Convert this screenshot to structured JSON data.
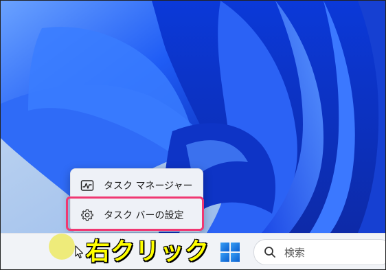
{
  "context_menu": {
    "items": [
      {
        "label": "タスク マネージャー",
        "icon": "task-manager-icon"
      },
      {
        "label": "タスク バーの設定",
        "icon": "gear-icon"
      }
    ]
  },
  "annotation": {
    "text": "右クリック",
    "color": "#ffff00"
  },
  "taskbar": {
    "search": {
      "placeholder": "検索",
      "icon": "search-icon"
    },
    "start_icon": "windows-logo-icon"
  },
  "colors": {
    "highlight": "#f03772",
    "wallpaper_blue": "#1a4ff0",
    "taskbar": "#f1f3f7"
  }
}
